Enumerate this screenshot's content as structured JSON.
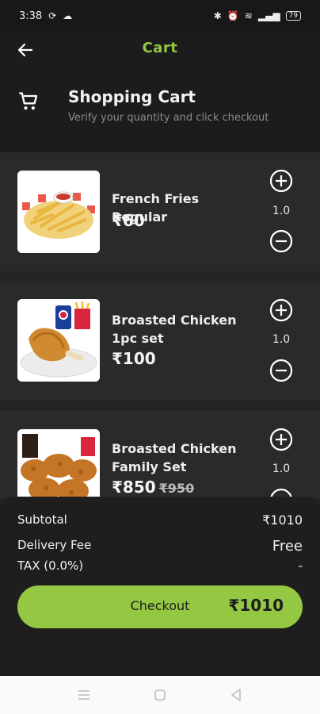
{
  "status_bar": {
    "time": "3:38",
    "battery": "79"
  },
  "app_bar": {
    "title": "Cart"
  },
  "header": {
    "title": "Shopping Cart",
    "subtitle": "Verify your quantity and click checkout"
  },
  "items": [
    {
      "name": "French Fries Regular",
      "price": "₹60",
      "quantity": "1.0"
    },
    {
      "name": "Broasted Chicken 1pc set",
      "price": "₹100",
      "quantity": "1.0"
    },
    {
      "name": "Broasted Chicken Family Set",
      "price": "₹850",
      "old_price": "₹950",
      "quantity": "1.0"
    }
  ],
  "summary": {
    "subtotal_label": "Subtotal",
    "subtotal_value": "₹1010",
    "delivery_label": "Delivery Fee",
    "delivery_value": "Free",
    "tax_label": "TAX (0.0%)",
    "tax_value": "-"
  },
  "checkout": {
    "label": "Checkout",
    "amount": "₹1010"
  },
  "colors": {
    "accent": "#95c842",
    "background": "#232323",
    "card": "#2a2a2a"
  },
  "icons": [
    "back-arrow-icon",
    "cart-icon",
    "plus-icon",
    "minus-icon",
    "menu-icon",
    "home-icon",
    "back-icon"
  ]
}
